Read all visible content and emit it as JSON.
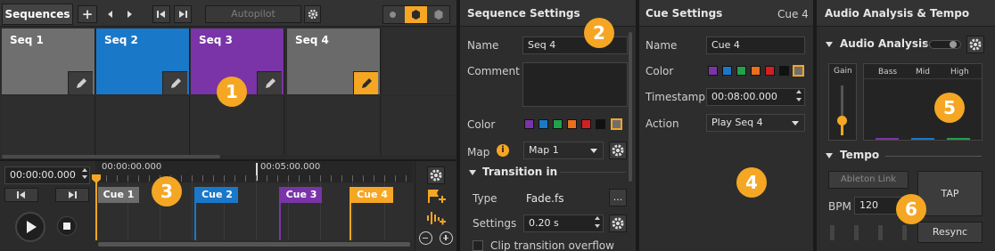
{
  "sequences_panel": {
    "tab_label": "Sequences",
    "add_label": "+",
    "autopilot_label": "Autopilot",
    "tiles": [
      {
        "label": "Seq 1",
        "color": "#6f6f6f"
      },
      {
        "label": "Seq 2",
        "color": "#1a78c9"
      },
      {
        "label": "Seq 3",
        "color": "#7a34a8"
      },
      {
        "label": "Seq 4",
        "color": "#6a6a6a"
      }
    ]
  },
  "timeline": {
    "time_value": "00:00:00.000",
    "ruler_start": "00:00:00.000",
    "ruler_mark": "00:05:00.000",
    "cues": [
      {
        "label": "Cue 1",
        "color": "#6c6c6c"
      },
      {
        "label": "Cue 2",
        "color": "#1a78c9"
      },
      {
        "label": "Cue 3",
        "color": "#7a34a8"
      },
      {
        "label": "Cue 4",
        "color": "#f5a623"
      }
    ]
  },
  "sequence_settings": {
    "title": "Sequence Settings",
    "name_label": "Name",
    "name_value": "Seq 4",
    "comment_label": "Comment",
    "color_label": "Color",
    "map_label": "Map",
    "map_value": "Map 1",
    "transition_label": "Transition in",
    "type_label": "Type",
    "type_value": "Fade.fs",
    "type_button": "...",
    "settings_label": "Settings",
    "settings_value": "0.20 s",
    "overflow_label": "Clip transition overflow"
  },
  "cue_settings": {
    "title": "Cue Settings",
    "cue_id": "Cue 4",
    "name_label": "Name",
    "name_value": "Cue 4",
    "color_label": "Color",
    "timestamp_label": "Timestamp",
    "timestamp_value": "00:08:00.000",
    "action_label": "Action",
    "action_value": "Play Seq 4"
  },
  "audio": {
    "title": "Audio Analysis & Tempo",
    "analysis_label": "Audio Analysis",
    "gain_label": "Gain",
    "bass_label": "Bass",
    "mid_label": "Mid",
    "high_label": "High",
    "tempo_label": "Tempo",
    "ableton_label": "Ableton Link",
    "tap_label": "TAP",
    "bpm_label": "BPM",
    "bpm_value": "120",
    "resync_label": "Resync"
  },
  "swatch_colors": [
    "#7a34a8",
    "#1a78c9",
    "#22a04a",
    "#e8701e",
    "#d42020",
    "#111111",
    "#6f6f6f"
  ],
  "callouts": [
    "1",
    "2",
    "3",
    "4",
    "5",
    "6"
  ]
}
